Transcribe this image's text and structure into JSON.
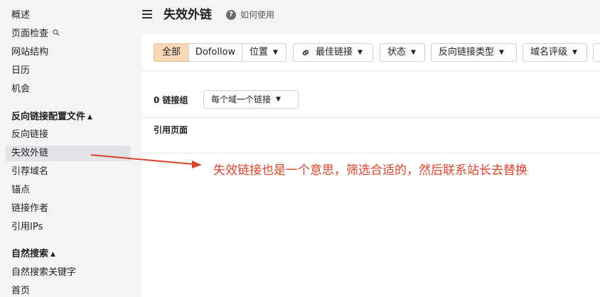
{
  "sidebar": {
    "items": [
      {
        "label": "概述"
      },
      {
        "label": "页面检查"
      },
      {
        "label": "网站结构"
      },
      {
        "label": "日历"
      },
      {
        "label": "机会"
      }
    ],
    "section_backlinks": "反向链接配置文件",
    "backlink_items": [
      {
        "label": "反向链接"
      },
      {
        "label": "失效外链"
      },
      {
        "label": "引荐域名"
      },
      {
        "label": "锚点"
      },
      {
        "label": "链接作者"
      },
      {
        "label": "引用IPs"
      }
    ],
    "section_organic": "自然搜索",
    "organic_items": [
      {
        "label": "自然搜索关键字"
      },
      {
        "label": "首页"
      }
    ]
  },
  "header": {
    "title": "失效外链",
    "help_label": "如何使用",
    "help_icon": "question-circle-icon"
  },
  "filters": {
    "all": "全部",
    "dofollow": "Dofollow",
    "position": "位置",
    "best_links": "最佳链接",
    "status": "状态",
    "backlink_type": "反向链接类型",
    "domain_rating": "域名评级",
    "active_color": "#fbd9b8"
  },
  "group": {
    "count": "0 链接组",
    "per_domain": "每个域一个链接"
  },
  "table": {
    "col_referring_page": "引用页面"
  },
  "annotation": {
    "text": "失效链接也是一个意思，筛选合适的，然后联系站长去替换",
    "color": "#d9442b"
  }
}
